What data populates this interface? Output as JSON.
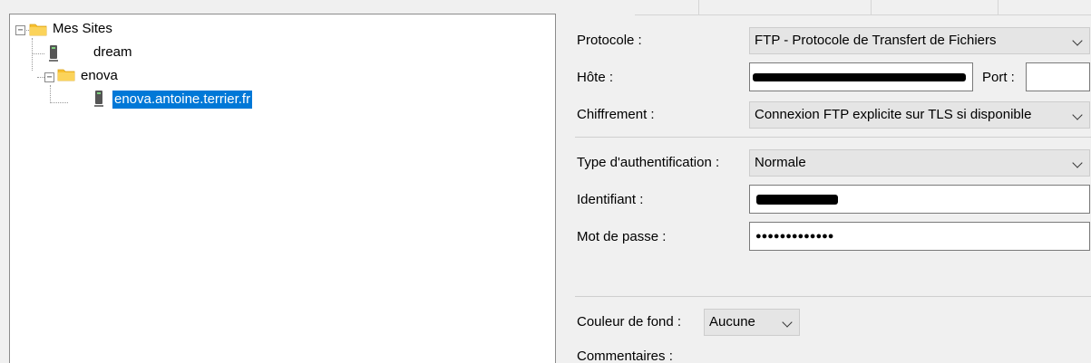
{
  "tree": {
    "root": {
      "label": "Mes Sites",
      "expander": "−"
    },
    "dream": {
      "label": "dream"
    },
    "enova_folder": {
      "label": "enova",
      "expander": "−"
    },
    "enova_site": {
      "label": "enova.antoine.terrier.fr"
    }
  },
  "form": {
    "protocol": {
      "label": "Protocole :",
      "value": "FTP - Protocole de Transfert de Fichiers"
    },
    "host": {
      "label": "Hôte :",
      "value": ""
    },
    "port": {
      "label": "Port :",
      "value": ""
    },
    "encryption": {
      "label": "Chiffrement :",
      "value": "Connexion FTP explicite sur TLS si disponible"
    },
    "auth_type": {
      "label": "Type d'authentification :",
      "value": "Normale"
    },
    "username": {
      "label": "Identifiant :",
      "value": ""
    },
    "password": {
      "label": "Mot de passe :",
      "value": "●●●●●●●●●●●●●"
    },
    "background_color": {
      "label": "Couleur de fond :",
      "value": "Aucune"
    },
    "comments": {
      "label": "Commentaires :"
    }
  },
  "colors": {
    "selection": "#0078d7",
    "folder": "#f8c02f"
  }
}
